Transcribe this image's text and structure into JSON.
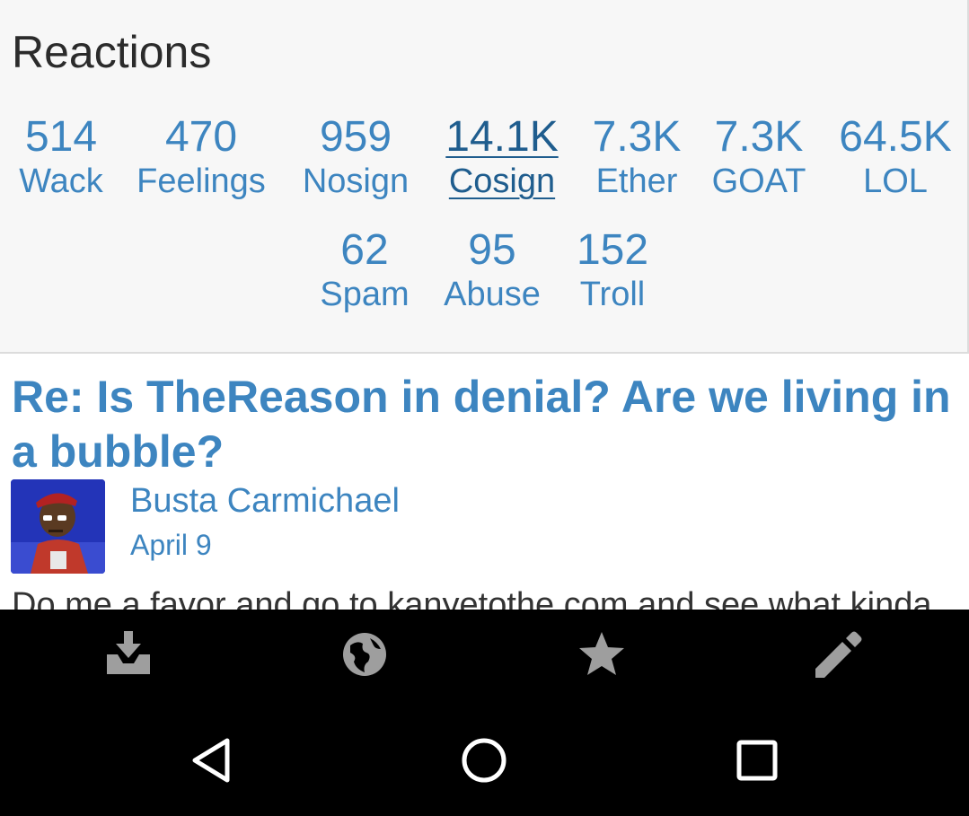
{
  "reactions": {
    "title": "Reactions",
    "row1": [
      {
        "count": "514",
        "label": "Wack"
      },
      {
        "count": "470",
        "label": "Feelings"
      },
      {
        "count": "959",
        "label": "Nosign"
      },
      {
        "count": "14.1K",
        "label": "Cosign"
      },
      {
        "count": "7.3K",
        "label": "Ether"
      },
      {
        "count": "7.3K",
        "label": "GOAT"
      },
      {
        "count": "64.5K",
        "label": "LOL"
      }
    ],
    "row2": [
      {
        "count": "62",
        "label": "Spam"
      },
      {
        "count": "95",
        "label": "Abuse"
      },
      {
        "count": "152",
        "label": "Troll"
      }
    ],
    "active": "Cosign"
  },
  "post": {
    "title": "Re: Is TheReason in denial? Are we living in a bubble?",
    "author": "Busta Carmichael",
    "date": "April 9",
    "body_preview": "Do me a favor and go to kanyetothe.com and see what kinda"
  },
  "toolbar": {
    "icons": [
      "inbox-download-icon",
      "globe-icon",
      "star-icon",
      "pencil-icon"
    ]
  },
  "colors": {
    "link": "#3d85c0",
    "panel_bg": "#f7f7f7",
    "toolbar_icon": "#9e9e9e",
    "nav_bar": "#000000"
  }
}
